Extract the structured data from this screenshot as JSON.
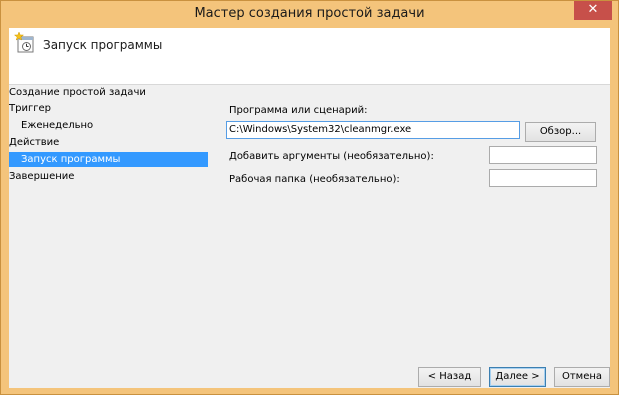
{
  "window": {
    "title": "Мастер создания простой задачи",
    "close_glyph": "✕"
  },
  "header": {
    "icon": "task-scheduler-icon",
    "title": "Запуск программы"
  },
  "sidebar": {
    "items": [
      {
        "label": "Создание простой задачи",
        "level": 0,
        "selected": false
      },
      {
        "label": "Триггер",
        "level": 0,
        "selected": false
      },
      {
        "label": "Еженедельно",
        "level": 1,
        "selected": false
      },
      {
        "label": "Действие",
        "level": 0,
        "selected": false
      },
      {
        "label": "Запуск программы",
        "level": 1,
        "selected": true
      },
      {
        "label": "Завершение",
        "level": 0,
        "selected": false
      }
    ]
  },
  "form": {
    "program_label": "Программа или сценарий:",
    "program_value": "C:\\Windows\\System32\\cleanmgr.exe",
    "browse_label": "Обзор...",
    "args_label": "Добавить аргументы (необязательно):",
    "args_value": "",
    "workdir_label": "Рабочая папка (необязательно):",
    "workdir_value": ""
  },
  "footer": {
    "back_label": "< Назад",
    "next_label": "Далее >",
    "cancel_label": "Отмена"
  },
  "colors": {
    "titlebar": "#f4c47b",
    "close": "#c7504a",
    "selection": "#3399ff",
    "panel": "#f0f0f0"
  }
}
